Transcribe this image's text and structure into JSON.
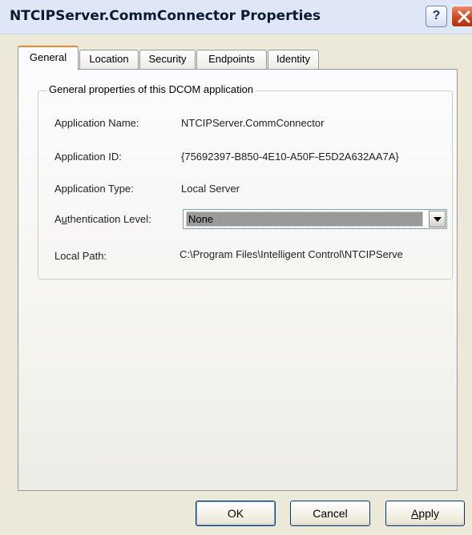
{
  "window": {
    "title": "NTCIPServer.CommConnector Properties",
    "help_label": "?",
    "close_icon": "close-icon"
  },
  "tabs": [
    {
      "label": "General",
      "active": true
    },
    {
      "label": "Location",
      "active": false
    },
    {
      "label": "Security",
      "active": false
    },
    {
      "label": "Endpoints",
      "active": false
    },
    {
      "label": "Identity",
      "active": false
    }
  ],
  "group": {
    "title": "General properties of this DCOM application",
    "rows": [
      {
        "label": "Application Name:",
        "value": "NTCIPServer.CommConnector"
      },
      {
        "label": "Application ID:",
        "value": "{75692397-B850-4E10-A50F-E5D2A632AA7A}"
      },
      {
        "label": "Application Type:",
        "value": "Local Server"
      },
      {
        "label_pre": "A",
        "label_accel": "u",
        "label_post": "thentication Level:",
        "value": "None"
      },
      {
        "label": "Local Path:",
        "value": "C:\\Program Files\\Intelligent Control\\NTCIPServe"
      }
    ]
  },
  "buttons": {
    "ok": "OK",
    "cancel": "Cancel",
    "apply_accel": "A",
    "apply_rest": "pply"
  },
  "colors": {
    "accent_tab": "#e68b2c",
    "close_red": "#c9431b",
    "dialog_bg": "#ece9d8"
  }
}
